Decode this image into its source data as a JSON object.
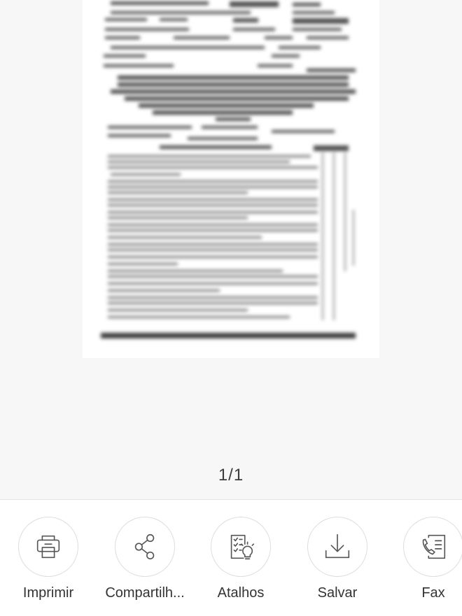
{
  "page_indicator": "1/1",
  "actions": [
    {
      "label": "Imprimir",
      "icon": "printer-icon"
    },
    {
      "label": "Compartilh...",
      "icon": "share-icon"
    },
    {
      "label": "Atalhos",
      "icon": "shortcuts-icon"
    },
    {
      "label": "Salvar",
      "icon": "download-icon"
    },
    {
      "label": "Fax",
      "icon": "fax-icon"
    }
  ],
  "colors": {
    "background": "#f7f7f7",
    "toolbar": "#ffffff",
    "icon_stroke": "#555555",
    "text": "#333333"
  }
}
